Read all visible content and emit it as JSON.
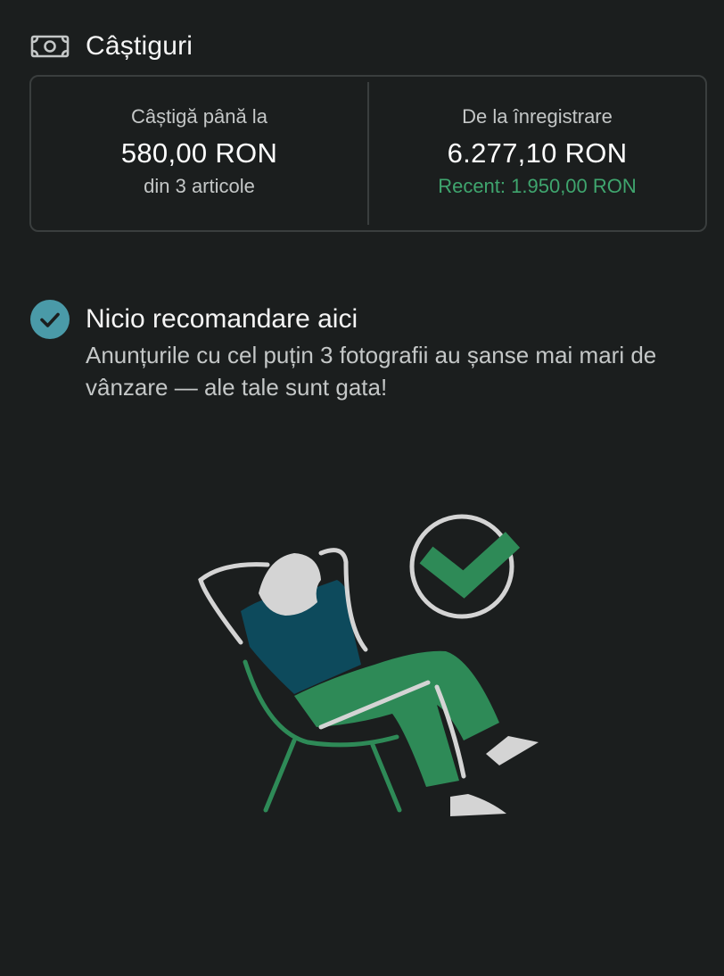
{
  "earnings": {
    "title": "Câștiguri",
    "icon": "money-icon",
    "potential": {
      "label": "Câștigă până la",
      "value": "580,00 RON",
      "sub": "din 3 articole"
    },
    "total": {
      "label": "De la înregistrare",
      "value": "6.277,10 RON",
      "recent": "Recent: 1.950,00 RON"
    }
  },
  "recommendation": {
    "icon": "check-circle-icon",
    "title": "Nicio recomandare aici",
    "description": "Anunțurile cu cel puțin 3 fotografii au șanse mai mari de vânzare — ale tale sunt gata!"
  },
  "colors": {
    "background": "#1b1e1e",
    "accent_teal": "#4a9aa8",
    "accent_green": "#3fa56e",
    "illustration_green": "#2e8a57",
    "illustration_navy": "#0d4a5c"
  }
}
